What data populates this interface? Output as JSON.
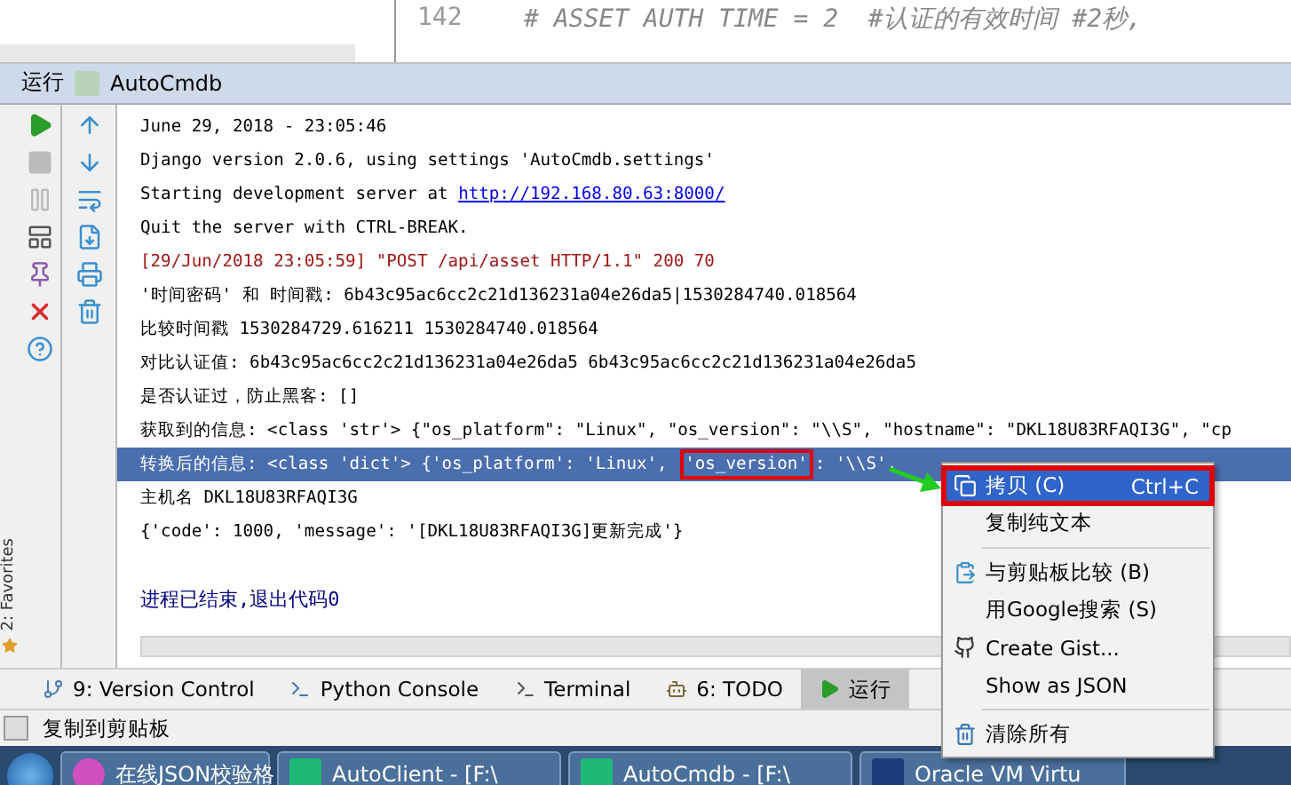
{
  "editor": {
    "line_number": "142",
    "code": "# ASSET AUTH TIME = 2  #认证的有效时间 #2秒,"
  },
  "run_panel": {
    "title": "运行",
    "config": "AutoCmdb"
  },
  "favorites_tab": "2: Favorites",
  "console": {
    "lines": [
      {
        "kind": "text",
        "text": "June 29, 2018 - 23:05:46",
        "selected": false
      },
      {
        "kind": "text",
        "text": "Django version 2.0.6, using settings 'AutoCmdb.settings'",
        "selected": false
      },
      {
        "kind": "link",
        "text": "Starting development server at ",
        "link": "http://192.168.80.63:8000/",
        "selected": false
      },
      {
        "kind": "text",
        "text": "Quit the server with CTRL-BREAK.",
        "selected": false
      },
      {
        "kind": "log",
        "text": "[29/Jun/2018 23:05:59] \"POST /api/asset HTTP/1.1\" 200 70",
        "selected": false
      },
      {
        "kind": "text",
        "text": "'时间密码' 和 时间戳: 6b43c95ac6cc2c21d136231a04e26da5|1530284740.018564",
        "selected": false
      },
      {
        "kind": "text",
        "text": "比较时间戳 1530284729.616211 1530284740.018564",
        "selected": false
      },
      {
        "kind": "text",
        "text": "对比认证值: 6b43c95ac6cc2c21d136231a04e26da5 6b43c95ac6cc2c21d136231a04e26da5",
        "selected": false
      },
      {
        "kind": "text",
        "text": "是否认证过，防止黑客: []",
        "selected": false
      },
      {
        "kind": "text",
        "text": "获取到的信息: <class 'str'> {\"os_platform\": \"Linux\", \"os_version\": \"\\\\S\", \"hostname\": \"DKL18U83RFAQI3G\", \"cp",
        "selected": false
      },
      {
        "kind": "framed",
        "before": "转换后的信息: <class 'dict'> {'os_platform': 'Linux', ",
        "framed": "'os_version'",
        "after": ": '\\\\S',",
        "selected": true
      },
      {
        "kind": "text",
        "text": "主机名 DKL18U83RFAQI3G",
        "selected": false
      },
      {
        "kind": "text",
        "text": "{'code': 1000, 'message': '[DKL18U83RFAQI3G]更新完成'}",
        "selected": false
      },
      {
        "kind": "blank",
        "selected": false
      },
      {
        "kind": "exit",
        "text": "进程已结束,退出代码0",
        "selected": false
      }
    ]
  },
  "context_menu": {
    "items": [
      {
        "kind": "copy",
        "label": "拷贝 (C)",
        "shortcut": "Ctrl+C",
        "selected": true
      },
      {
        "kind": "plain",
        "label": "复制纯文本",
        "selected": false
      },
      {
        "kind": "separator"
      },
      {
        "kind": "compare",
        "label": "与剪贴板比较 (B)",
        "selected": false
      },
      {
        "kind": "plain",
        "label": "用Google搜索 (S)",
        "selected": false
      },
      {
        "kind": "gist",
        "label": "Create Gist...",
        "selected": false
      },
      {
        "kind": "plain",
        "label": "Show as JSON",
        "selected": false
      },
      {
        "kind": "separator"
      },
      {
        "kind": "clear",
        "label": "清除所有",
        "selected": false
      }
    ]
  },
  "tool_tabs": [
    {
      "kind": "vcs",
      "label": "9: Version Control",
      "selected": false
    },
    {
      "kind": "python",
      "label": "Python Console",
      "selected": false
    },
    {
      "kind": "terminal",
      "label": "Terminal",
      "selected": false
    },
    {
      "kind": "todo",
      "label": "6: TODO",
      "selected": false
    },
    {
      "kind": "run",
      "label": "运行",
      "selected": true
    }
  ],
  "status_bar": {
    "text": "复制到剪贴板"
  },
  "taskbar": {
    "buttons": [
      {
        "kind": "browser",
        "label": "在线JSON校验格"
      },
      {
        "kind": "pycharm",
        "label": "AutoClient - [F:\\"
      },
      {
        "kind": "pycharm",
        "label": "AutoCmdb - [F:\\"
      },
      {
        "kind": "vbox",
        "label": "Oracle VM Virtu"
      }
    ]
  }
}
